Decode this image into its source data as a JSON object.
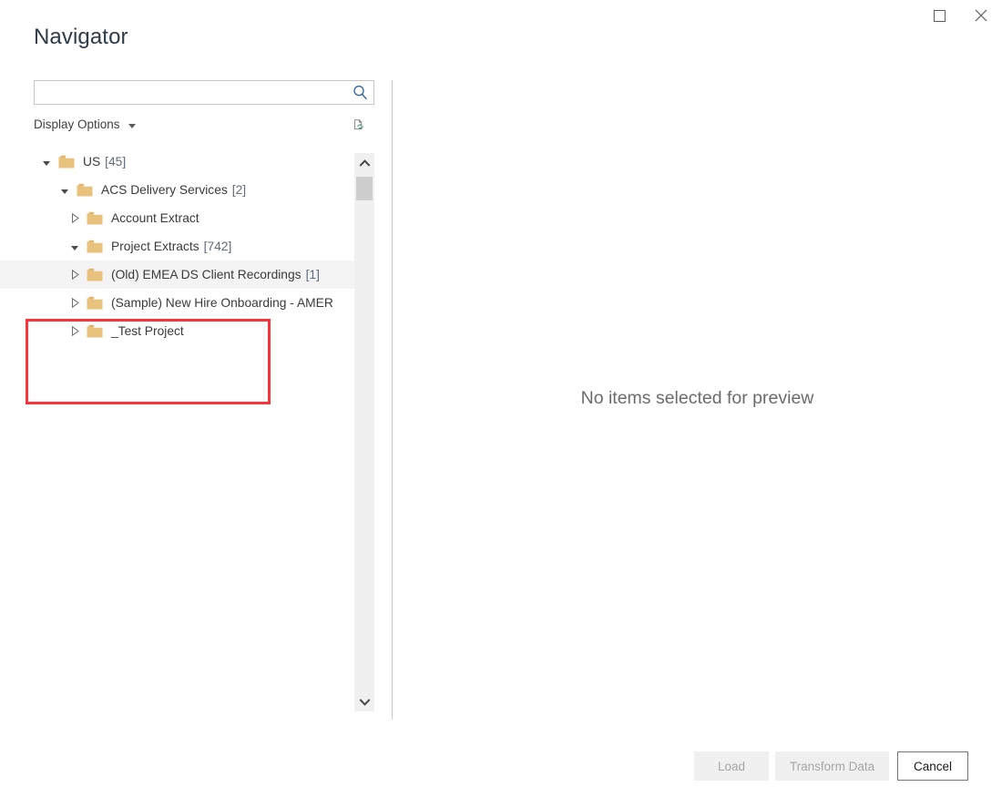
{
  "window": {
    "title": "Navigator",
    "controls": [
      {
        "name": "maximize",
        "icon": "square-icon",
        "label": ""
      },
      {
        "name": "close",
        "icon": "close-icon",
        "label": "✕"
      }
    ]
  },
  "search": {
    "value": "",
    "placeholder": "",
    "icon": "search-icon"
  },
  "options": {
    "display_options_label": "Display Options",
    "caret_icon": "chevron-down-icon",
    "refresh_icon": "refresh-preview-icon"
  },
  "tree": {
    "items": [
      {
        "label": "US",
        "count": "[45]",
        "level": 1,
        "expanded": true,
        "hovered": false
      },
      {
        "label": "ACS Delivery Services",
        "count": "[2]",
        "level": 2,
        "expanded": true,
        "hovered": false
      },
      {
        "label": "Account Extract",
        "count": "",
        "level": 3,
        "expanded": false,
        "hovered": false
      },
      {
        "label": "Project Extracts",
        "count": "[742]",
        "level": 3,
        "expanded": true,
        "hovered": false
      },
      {
        "label": "(Old) EMEA DS Client Recordings",
        "count": "[1]",
        "level": 4,
        "expanded": false,
        "hovered": true
      },
      {
        "label": "(Sample) New Hire Onboarding - AMER",
        "count": "",
        "level": 4,
        "expanded": false,
        "hovered": false
      },
      {
        "label": "_Test Project",
        "count": "",
        "level": 4,
        "expanded": false,
        "hovered": false
      }
    ],
    "rows": {
      "r0": {
        "label": "US",
        "count": "[45]"
      },
      "r1": {
        "label": "ACS Delivery Services",
        "count": "[2]"
      },
      "r2": {
        "label": "Account Extract",
        "count": ""
      },
      "r3": {
        "label": "Project Extracts",
        "count": "[742]"
      },
      "r4": {
        "label": "(Old) EMEA DS Client Recordings",
        "count": "[1]"
      },
      "r5": {
        "label": "(Sample) New Hire Onboarding - AMER",
        "count": ""
      },
      "r6": {
        "label": "_Test Project",
        "count": ""
      }
    }
  },
  "scrollbar": {
    "up_icon": "chevron-up-icon",
    "down_icon": "chevron-down-icon"
  },
  "preview": {
    "empty_message": "No items selected for preview"
  },
  "footer": {
    "load_label": "Load",
    "transform_label": "Transform Data",
    "cancel_label": "Cancel"
  },
  "annotation": {
    "color": "#f8353a"
  },
  "colors": {
    "folder_fill": "#e9c27d",
    "folder_tab": "#e0b468",
    "accent_blue": "#2a6099",
    "title_text": "#2f3b47",
    "highlight_row": "#f4f4f4"
  }
}
